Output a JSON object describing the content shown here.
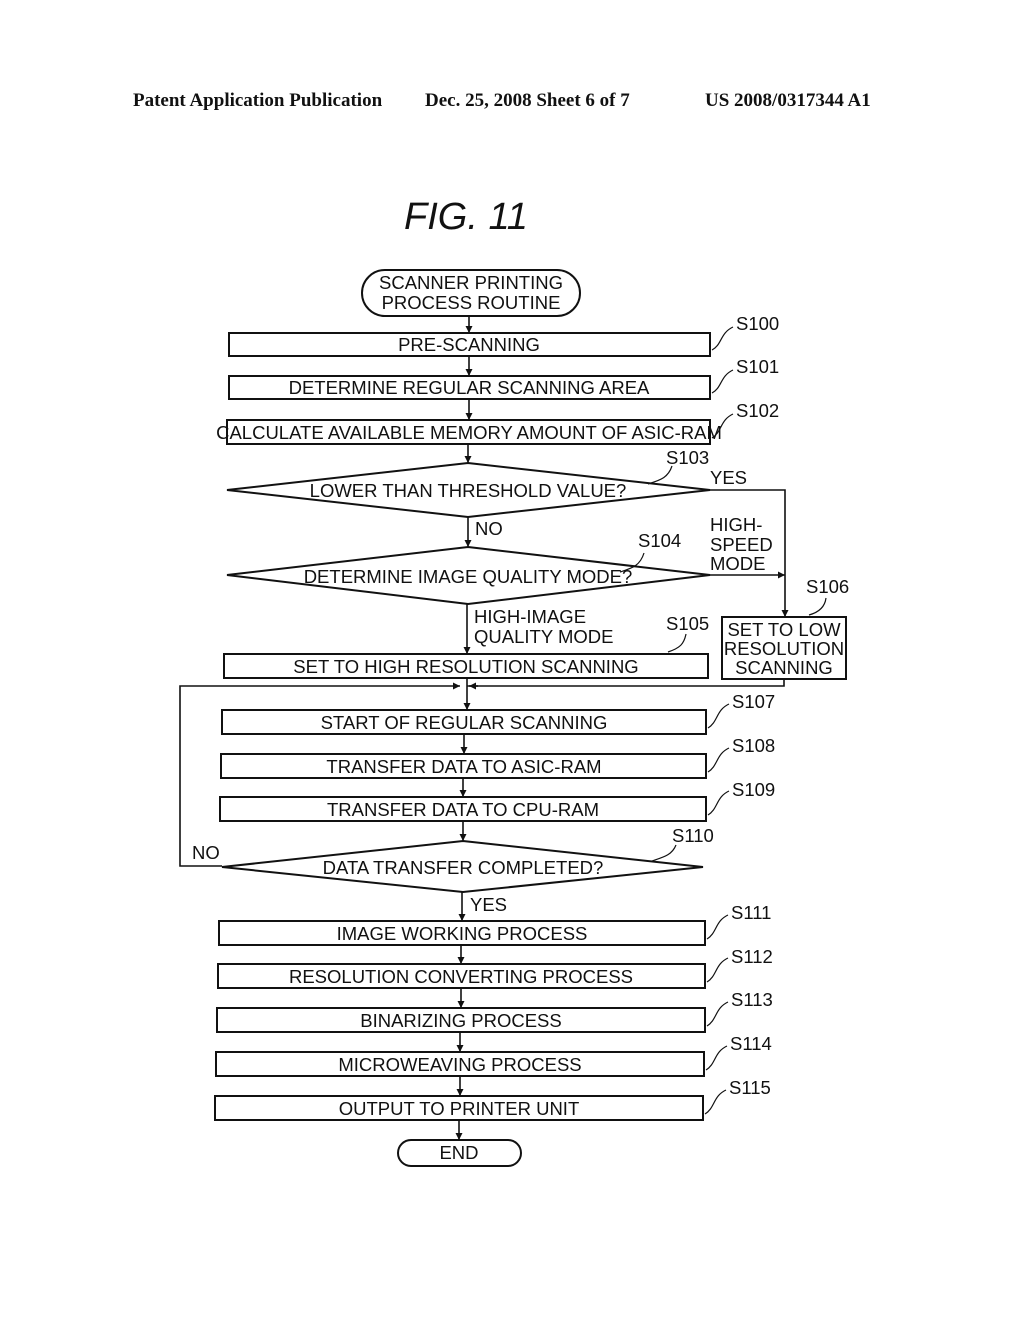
{
  "header": {
    "publication": "Patent Application Publication",
    "date_sheet": "Dec. 25, 2008   Sheet 6 of 7",
    "patent_number": "US 2008/0317344 A1"
  },
  "figure": {
    "title": "FIG. 11",
    "start": [
      "SCANNER PRINTING",
      "PROCESS ROUTINE"
    ],
    "end": "END",
    "steps": [
      {
        "id": "S100",
        "label": "PRE-SCANNING"
      },
      {
        "id": "S101",
        "label": "DETERMINE REGULAR SCANNING AREA"
      },
      {
        "id": "S102",
        "label": "CALCULATE AVAILABLE MEMORY AMOUNT OF ASIC-RAM"
      },
      {
        "id": "S103",
        "label": "LOWER THAN THRESHOLD VALUE?"
      },
      {
        "id": "S104",
        "label": "DETERMINE IMAGE QUALITY MODE?"
      },
      {
        "id": "S105",
        "label": "SET TO HIGH RESOLUTION SCANNING"
      },
      {
        "id": "S106",
        "label": [
          "SET TO LOW",
          "RESOLUTION",
          "SCANNING"
        ]
      },
      {
        "id": "S107",
        "label": "START OF REGULAR SCANNING"
      },
      {
        "id": "S108",
        "label": "TRANSFER DATA TO ASIC-RAM"
      },
      {
        "id": "S109",
        "label": "TRANSFER DATA TO CPU-RAM"
      },
      {
        "id": "S110",
        "label": "DATA TRANSFER COMPLETED?"
      },
      {
        "id": "S111",
        "label": "IMAGE WORKING PROCESS"
      },
      {
        "id": "S112",
        "label": "RESOLUTION CONVERTING PROCESS"
      },
      {
        "id": "S113",
        "label": "BINARIZING PROCESS"
      },
      {
        "id": "S114",
        "label": "MICROWEAVING PROCESS"
      },
      {
        "id": "S115",
        "label": "OUTPUT TO PRINTER UNIT"
      }
    ],
    "branch_labels": {
      "s103_yes": "YES",
      "s103_no": "NO",
      "s104_high_speed": [
        "HIGH-",
        "SPEED",
        "MODE"
      ],
      "s104_high_image": [
        "HIGH-IMAGE",
        "QUALITY MODE"
      ],
      "s110_no": "NO",
      "s110_yes": "YES"
    }
  }
}
